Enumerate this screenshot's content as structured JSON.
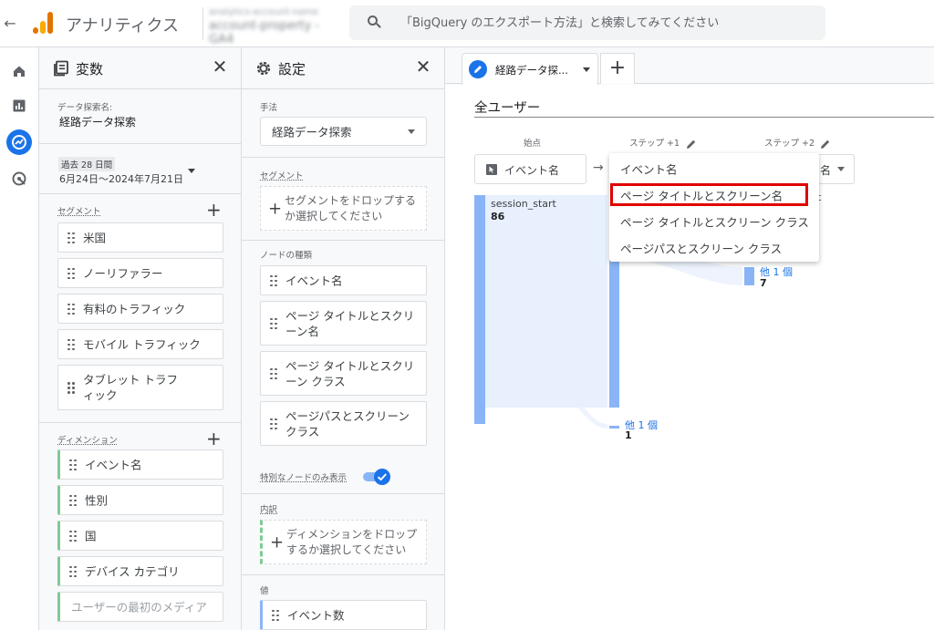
{
  "topbar": {
    "app_title": "アナリティクス",
    "account_line1": "analytics-account-name",
    "account_line2": "account-property - GA4",
    "search_placeholder": "「BigQuery のエクスポート方法」と検索してみてください"
  },
  "rail": {
    "items": [
      "home-icon",
      "reports-icon",
      "explore-icon",
      "advertising-icon"
    ],
    "active": "explore-icon"
  },
  "variables": {
    "title": "変数",
    "exploration_name_label": "データ探索名:",
    "exploration_name": "経路データ探索",
    "date_range_label": "過去 28 日間",
    "date_range": "6月24日～2024年7月21日",
    "segments_label": "セグメント",
    "segments": [
      "米国",
      "ノーリファラー",
      "有料のトラフィック",
      "モバイル トラフィック",
      "タブレット トラフィック"
    ],
    "dimensions_label": "ディメンション",
    "dimensions": [
      "イベント名",
      "性別",
      "国",
      "デバイス カテゴリ",
      "ユーザーの最初のメディア"
    ]
  },
  "settings": {
    "title": "設定",
    "technique_label": "手法",
    "technique_value": "経路データ探索",
    "segment_label": "セグメント",
    "segment_drop": "セグメントをドロップするか選択してください",
    "node_type_label": "ノードの種類",
    "node_types": [
      "イベント名",
      "ページ タイトルとスクリーン名",
      "ページ タイトルとスクリーン クラス",
      "ページパスとスクリーン クラス"
    ],
    "unique_nodes_label": "特別なノードのみ表示",
    "unique_nodes_on": true,
    "breakdown_label": "内訳",
    "breakdown_drop": "ディメンションをドロップするか選択してください",
    "values_label": "値",
    "value_item": "イベント数"
  },
  "main": {
    "tab_label": "経路データ探...",
    "segment_title": "全ユーザー",
    "start_label": "始点",
    "step1_label": "ステップ +1",
    "step2_label": "ステップ +2",
    "start_node_type": "イベント名",
    "step2_partial": "名",
    "step2_partial_node": "t",
    "start_node": {
      "name": "session_start",
      "value": "86"
    },
    "other_step1": {
      "label": "他 1 個",
      "value": "1"
    },
    "other_step2": {
      "label": "他 1 個",
      "value": "7"
    }
  },
  "dropdown": {
    "items": [
      "イベント名",
      "ページ タイトルとスクリーン名",
      "ページ タイトルとスクリーン クラス",
      "ページパスとスクリーン クラス"
    ],
    "highlighted_index": 1,
    "highlight_color": "#e00000"
  },
  "colors": {
    "accent": "#1a73e8",
    "bar": "#8ab4f8",
    "dimension": "#81c995"
  }
}
